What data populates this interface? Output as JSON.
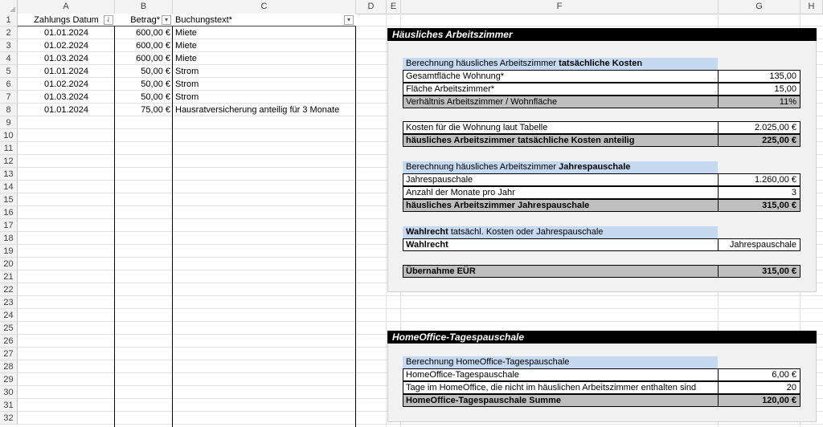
{
  "columns": [
    "A",
    "B",
    "C",
    "D",
    "E",
    "F",
    "G",
    "H"
  ],
  "rows": [
    "1",
    "2",
    "3",
    "4",
    "5",
    "6",
    "7",
    "8",
    "9",
    "10",
    "11",
    "12",
    "13",
    "14",
    "15",
    "16",
    "17",
    "18",
    "19",
    "20",
    "21",
    "22",
    "23",
    "24",
    "25",
    "26",
    "27",
    "28",
    "29",
    "30",
    "31",
    "32"
  ],
  "table": {
    "headers": [
      "Zahlungs Datum",
      "Betrag*",
      "Buchungstext*"
    ],
    "filter_icons": [
      "⇃",
      "▾",
      "▾"
    ],
    "data": [
      [
        "01.01.2024",
        "600,00 €",
        "Miete"
      ],
      [
        "01.02.2024",
        "600,00 €",
        "Miete"
      ],
      [
        "01.03.2024",
        "600,00 €",
        "Miete"
      ],
      [
        "01.01.2024",
        "50,00 €",
        "Strom"
      ],
      [
        "01.02.2024",
        "50,00 €",
        "Strom"
      ],
      [
        "01.03.2024",
        "50,00 €",
        "Strom"
      ],
      [
        "01.01.2024",
        "75,00 €",
        "Hausratversicherung anteilig für 3 Monate"
      ]
    ]
  },
  "panel1": {
    "title": "Häusliches Arbeitszimmer",
    "sec1_a": "Berechnung häusliches Arbeitszimmer ",
    "sec1_b": "tatsächliche Kosten",
    "r1_label": "Gesamtfläche Wohnung*",
    "r1_value": "135,00",
    "r2_label": "Fläche Arbeitszimmer*",
    "r2_value": "15,00",
    "r3_label": "Verhältnis Arbeitszimmer / Wohnfläche",
    "r3_value": "11%",
    "r4_label": "Kosten für die Wohnung laut Tabelle",
    "r4_value": "2.025,00 €",
    "r5_label": "häusliches Arbeitszimmer tatsächliche Kosten anteilig",
    "r5_value": "225,00 €",
    "sec2_a": "Berechnung häusliches Arbeitszimmer ",
    "sec2_b": "Jahrespauschale",
    "r6_label": "Jahrespauschale",
    "r6_value": "1.260,00 €",
    "r7_label": "Anzahl der Monate pro Jahr",
    "r7_value": "3",
    "r8_label": "häusliches Arbeitszimmer Jahrespauschale",
    "r8_value": "315,00 €",
    "sec3_a": "Wahlrecht",
    "sec3_b": " tatsächl. Kosten oder Jahrespauschale",
    "r9_label": "Wahlrecht",
    "r9_value": "Jahrespauschale",
    "r10_label": "Übernahme EÜR",
    "r10_value": "315,00 €"
  },
  "panel2": {
    "title": "HomeOffice-Tagespauschale",
    "sec1": "Berechnung HomeOffice-Tagespauschale",
    "r1_label": "HomeOffice-Tagespauschale",
    "r1_value": "6,00 €",
    "r2_label": "Tage im HomeOffice, die nicht im häuslichen Arbeitszimmer enthalten sind",
    "r2_value": "20",
    "r3_label": "HomeOffice-Tagespauschale Summe",
    "r3_value": "120,00 €"
  }
}
